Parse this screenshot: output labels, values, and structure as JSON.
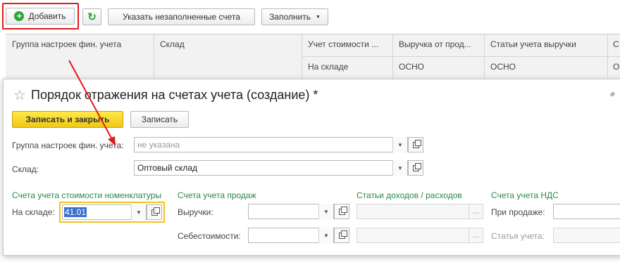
{
  "toolbar": {
    "add_label": "Добавить",
    "fill_missing_label": "Указать незаполненные счета",
    "fill_label": "Заполнить"
  },
  "table": {
    "headers": [
      "Группа настроек фин. учета",
      "Склад",
      "Учет стоимости ...",
      "Выручка от прод...",
      "Статьи учета выручки",
      "С"
    ],
    "row1": [
      "",
      "",
      "На складе",
      "ОСНО",
      "ОСНО",
      "О"
    ]
  },
  "dialog": {
    "title": "Порядок отражения на счетах учета (создание) *",
    "save_close_label": "Записать и закрыть",
    "save_label": "Записать",
    "group_label": "Группа настроек фин. учета:",
    "group_placeholder": "не указана",
    "warehouse_label": "Склад:",
    "warehouse_value": "Оптовый склад",
    "sections": {
      "nomenclature": "Счета учета стоимости номенклатуры",
      "sales": "Счета учета продаж",
      "income": "Статьи доходов / расходов",
      "vat": "Счета учета НДС"
    },
    "at_warehouse_label": "На складе:",
    "at_warehouse_value": "41.01",
    "revenue_label": "Выручки:",
    "cost_label": "Себестоимости:",
    "on_sale_label": "При продаже:",
    "account_item_label": "Статья учета:"
  },
  "colors": {
    "accent_green": "#2a8a45",
    "highlight_red": "#e01b1b",
    "primary_yellow": "#f5d21c"
  }
}
